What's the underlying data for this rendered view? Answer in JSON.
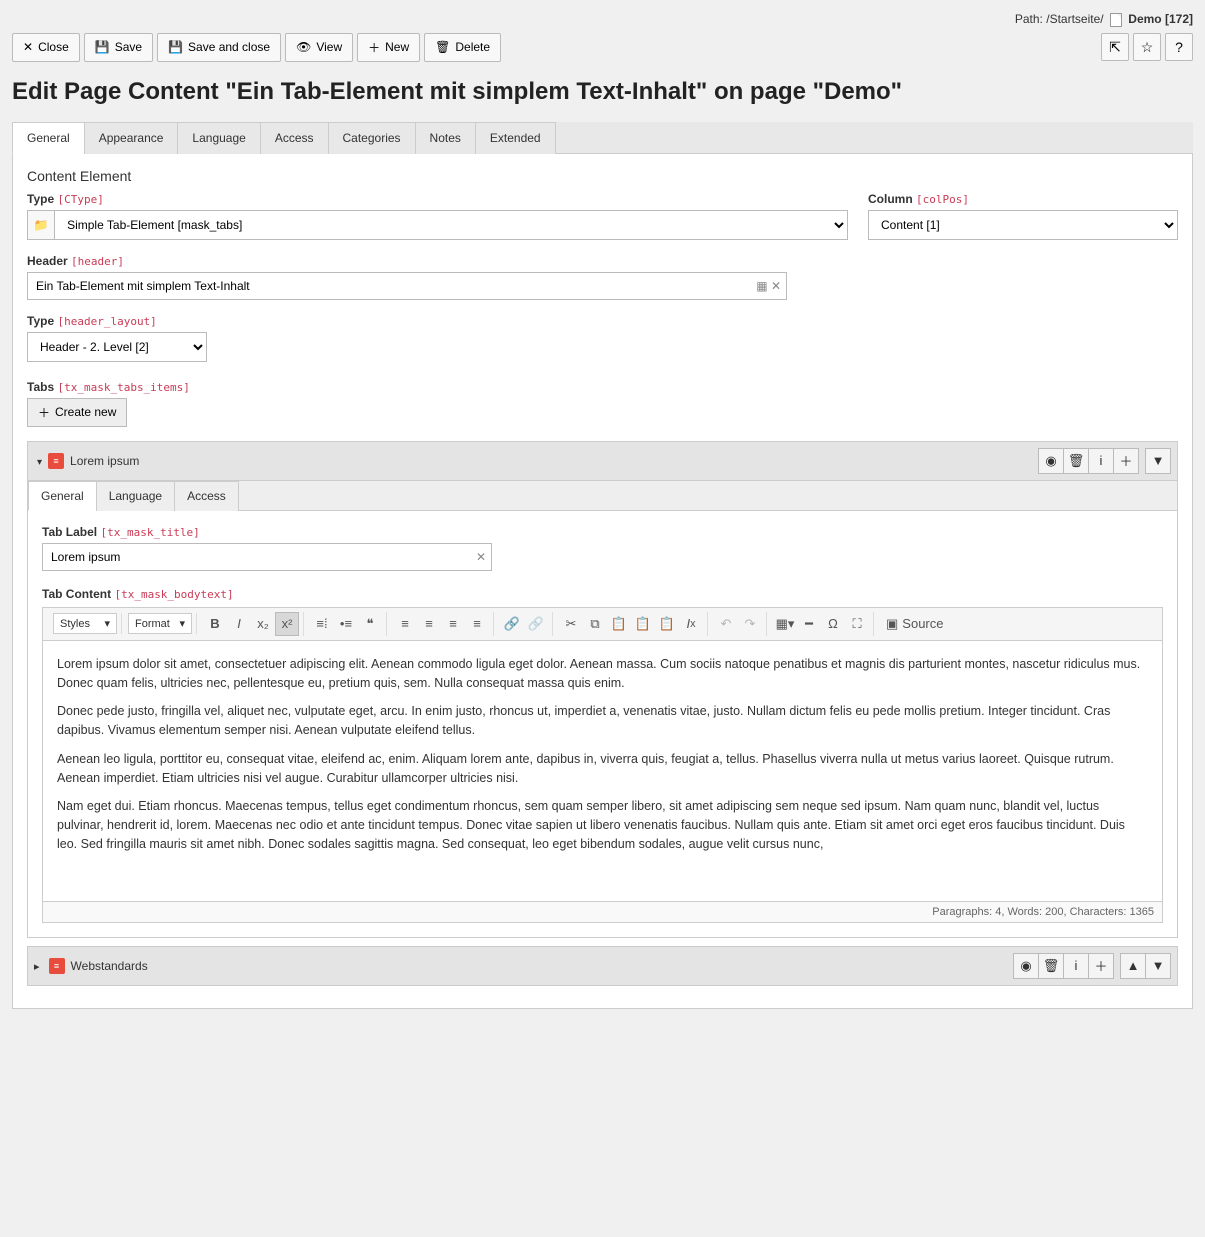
{
  "breadcrumb": {
    "path_label": "Path:",
    "root": "/Startseite/",
    "page": "Demo",
    "page_id": "[172]"
  },
  "toolbar": {
    "close": "Close",
    "save": "Save",
    "save_close": "Save and close",
    "view": "View",
    "new": "New",
    "delete": "Delete"
  },
  "page_title": "Edit Page Content \"Ein Tab-Element mit simplem Text-Inhalt\" on page \"Demo\"",
  "tabs": [
    "General",
    "Appearance",
    "Language",
    "Access",
    "Categories",
    "Notes",
    "Extended"
  ],
  "active_tab_index": 0,
  "section_heading": "Content Element",
  "fields": {
    "type": {
      "label": "Type",
      "tca": "[CType]",
      "value": "Simple Tab-Element [mask_tabs]"
    },
    "column": {
      "label": "Column",
      "tca": "[colPos]",
      "value": "Content [1]"
    },
    "header": {
      "label": "Header",
      "tca": "[header]",
      "value": "Ein Tab-Element mit simplem Text-Inhalt"
    },
    "header_layout": {
      "label": "Type",
      "tca": "[header_layout]",
      "value": "Header - 2. Level [2]"
    },
    "tabs_section": {
      "label": "Tabs",
      "tca": "[tx_mask_tabs_items]",
      "create_new": "Create new"
    }
  },
  "irre_items": [
    {
      "title": "Lorem ipsum",
      "expanded": true,
      "sub_tabs": [
        "General",
        "Language",
        "Access"
      ],
      "active_sub_tab": 0,
      "tab_label": {
        "label": "Tab Label",
        "tca": "[tx_mask_title]",
        "value": "Lorem ipsum"
      },
      "tab_content": {
        "label": "Tab Content",
        "tca": "[tx_mask_bodytext]",
        "rte": {
          "styles": "Styles",
          "format": "Format",
          "source": "Source",
          "paragraphs": [
            "Lorem ipsum dolor sit amet, consectetuer adipiscing elit. Aenean commodo ligula eget dolor. Aenean massa. Cum sociis natoque penatibus et magnis dis parturient montes, nascetur ridiculus mus. Donec quam felis, ultricies nec, pellentesque eu, pretium quis, sem. Nulla consequat massa quis enim.",
            "Donec pede justo, fringilla vel, aliquet nec, vulputate eget, arcu. In enim justo, rhoncus ut, imperdiet a, venenatis vitae, justo. Nullam dictum felis eu pede mollis pretium. Integer tincidunt. Cras dapibus. Vivamus elementum semper nisi. Aenean vulputate eleifend tellus.",
            "Aenean leo ligula, porttitor eu, consequat vitae, eleifend ac, enim. Aliquam lorem ante, dapibus in, viverra quis, feugiat a, tellus. Phasellus viverra nulla ut metus varius laoreet. Quisque rutrum. Aenean imperdiet. Etiam ultricies nisi vel augue. Curabitur ullamcorper ultricies nisi.",
            "Nam eget dui. Etiam rhoncus. Maecenas tempus, tellus eget condimentum rhoncus, sem quam semper libero, sit amet adipiscing sem neque sed ipsum. Nam quam nunc, blandit vel, luctus pulvinar, hendrerit id, lorem. Maecenas nec odio et ante tincidunt tempus. Donec vitae sapien ut libero venenatis faucibus. Nullam quis ante. Etiam sit amet orci eget eros faucibus tincidunt. Duis leo. Sed fringilla mauris sit amet nibh. Donec sodales sagittis magna. Sed consequat, leo eget bibendum sodales, augue velit cursus nunc,"
          ],
          "status": "Paragraphs: 4, Words: 200, Characters: 1365"
        }
      }
    },
    {
      "title": "Webstandards",
      "expanded": false
    }
  ]
}
